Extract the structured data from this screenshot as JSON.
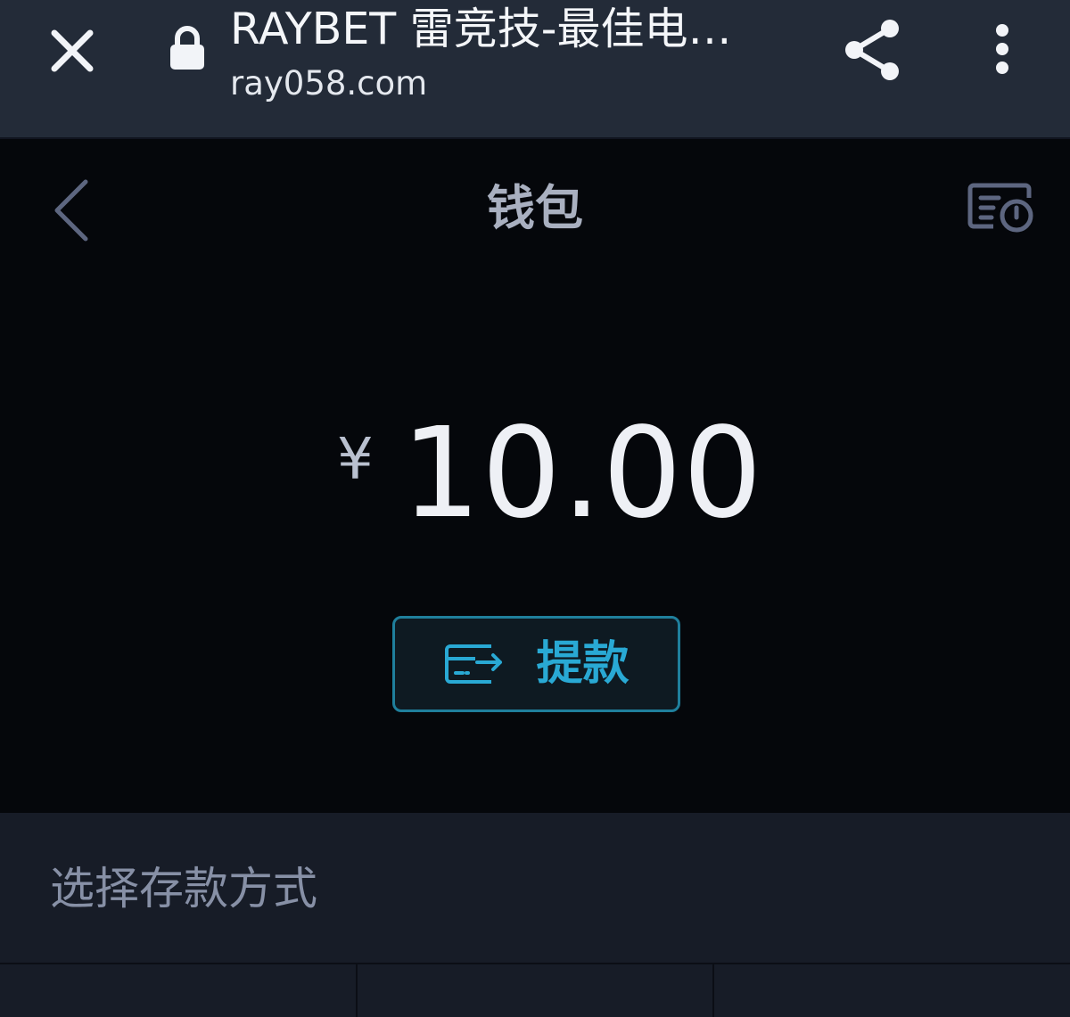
{
  "browser": {
    "title": "RAYBET 雷竞技-最佳电…",
    "url": "ray058.com",
    "icons": [
      "close-icon",
      "lock-icon",
      "share-icon",
      "more-vertical-icon"
    ]
  },
  "wallet": {
    "title": "钱包",
    "currency_symbol": "¥",
    "balance": "10.00",
    "withdraw_label": "提款",
    "icons": [
      "back-chevron-icon",
      "history-icon",
      "card-transfer-icon"
    ]
  },
  "deposit": {
    "section_title": "选择存款方式",
    "methods": [
      {},
      {},
      {}
    ]
  },
  "colors": {
    "browser_bar": "#232b38",
    "page_bg": "#05070b",
    "section_bg": "#171c27",
    "accent": "#29a9d4"
  }
}
